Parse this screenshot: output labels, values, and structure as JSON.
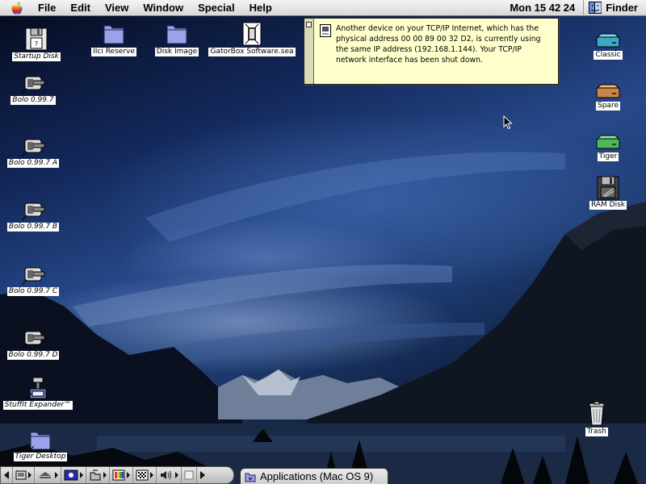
{
  "menubar": {
    "apple_icon": "apple-icon",
    "items": [
      "File",
      "Edit",
      "View",
      "Window",
      "Special",
      "Help"
    ],
    "clock": "Mon 15 42 24",
    "app_name": "Finder",
    "app_icon": "finder-icon"
  },
  "desktop_icons_left": [
    {
      "label": "Startup Disk",
      "icon": "startup-disk-icon"
    },
    {
      "label": "Bolo 0.99.7",
      "icon": "bolo-app-icon"
    },
    {
      "label": "Bolo 0.99.7 A",
      "icon": "bolo-app-icon"
    },
    {
      "label": "Bolo 0.99.7 B",
      "icon": "bolo-app-icon"
    },
    {
      "label": "Bolo 0.99.7 C",
      "icon": "bolo-app-icon"
    },
    {
      "label": "Bolo 0.99.7 D",
      "icon": "bolo-app-icon"
    },
    {
      "label": "StuffIt Expander™",
      "icon": "stuffit-icon"
    },
    {
      "label": "Tiger Desktop",
      "icon": "folder-icon"
    }
  ],
  "desktop_icons_top": [
    {
      "label": "IIci Reserve",
      "icon": "folder-icon"
    },
    {
      "label": "Disk Image",
      "icon": "folder-icon"
    },
    {
      "label": "GatorBox Software.sea",
      "icon": "sea-archive-icon"
    }
  ],
  "desktop_icons_right": [
    {
      "label": "Classic",
      "icon": "hard-drive-icon",
      "color": "#3aa8c8"
    },
    {
      "label": "Spare",
      "icon": "hard-drive-icon",
      "color": "#c8844a"
    },
    {
      "label": "Tiger",
      "icon": "hard-drive-icon",
      "color": "#4cb85a"
    },
    {
      "label": "RAM Disk",
      "icon": "ram-disk-icon"
    },
    {
      "label": "Trash",
      "icon": "trash-icon"
    }
  ],
  "alert": {
    "message": "Another device on your TCP/IP Internet, which has the physical address 00 00 89 00 32 D2, is currently using the same IP address (192.168.1.144). Your TCP/IP network interface has been shut down.",
    "icon": "notification-icon"
  },
  "control_strip": {
    "modules": [
      "strip-scroll-left-icon",
      "apple-talk-icon",
      "cd-eject-icon",
      "monitor-depth-icon",
      "file-sharing-icon",
      "color-depth-icon",
      "resolution-icon",
      "sound-volume-icon",
      "blank-module-icon",
      "strip-scroll-right-icon"
    ]
  },
  "app_switcher": {
    "label": "Applications (Mac OS 9)",
    "icon": "applications-folder-icon"
  }
}
